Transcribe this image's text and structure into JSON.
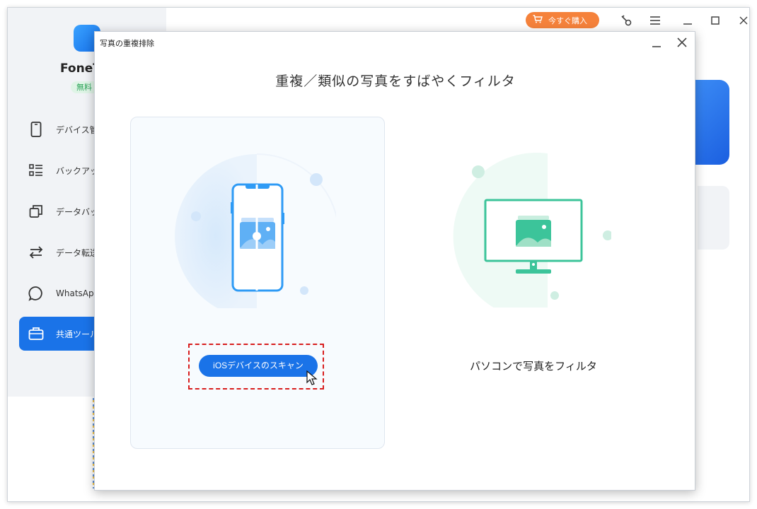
{
  "app": {
    "name": "FoneT",
    "plan_badge": "無料",
    "buy_button": "今すぐ購入"
  },
  "sidebar": {
    "items": [
      {
        "label": "デバイス管",
        "icon": "phone-icon"
      },
      {
        "label": "バックアッ",
        "icon": "list-icon"
      },
      {
        "label": "データバッ",
        "icon": "copy-icon"
      },
      {
        "label": "データ転送",
        "icon": "transfer-icon"
      },
      {
        "label": "WhatsApp",
        "icon": "chat-icon"
      },
      {
        "label": "共通ツール",
        "icon": "toolbox-icon",
        "active": true
      }
    ]
  },
  "dialog": {
    "title": "写真の重複排除",
    "heading": "重複／類似の写真をすばやくフィルタ",
    "scan_button": "iOSデバイスのスキャン",
    "pc_filter_label": "パソコンで写真をフィルタ"
  },
  "colors": {
    "accent": "#1a73e8",
    "buy": "#f5823b",
    "pc_green": "#3cc49a",
    "highlight_border": "#d81e1e"
  }
}
